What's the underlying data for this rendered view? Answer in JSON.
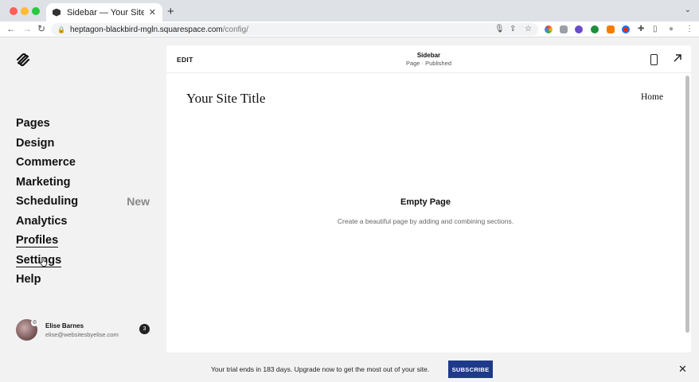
{
  "browser": {
    "tab_title": "Sidebar — Your Site Title",
    "tab_close": "✕",
    "new_tab": "+",
    "tab_menu": "⌄",
    "url_host": "heptagon-blackbird-mgln.squarespace.com",
    "url_path": "/config/",
    "back": "←",
    "forward": "→",
    "reload": "↻",
    "lock": "🔒",
    "mic": "🎙",
    "share": "⇪",
    "star": "☆",
    "puzzle": "✚",
    "sidebar_toggle": "▯",
    "profile": "●",
    "menu": "⋮"
  },
  "sidebar": {
    "items": [
      {
        "label": "Pages"
      },
      {
        "label": "Design"
      },
      {
        "label": "Commerce"
      },
      {
        "label": "Marketing"
      },
      {
        "label": "Scheduling",
        "badge": "New"
      },
      {
        "label": "Analytics"
      },
      {
        "label": "Profiles"
      },
      {
        "label": "Settings"
      },
      {
        "label": "Help"
      }
    ],
    "user": {
      "name": "Elise Barnes",
      "email": "elise@websitesbyelise.com",
      "notifications": "3",
      "gear": "⚙"
    }
  },
  "editor": {
    "edit_label": "EDIT",
    "page_name": "Sidebar",
    "page_status": "Page · Published",
    "site_title": "Your Site Title",
    "nav_home": "Home",
    "empty_title": "Empty Page",
    "empty_description": "Create a beautiful page by adding and combining sections."
  },
  "banner": {
    "text": "Your trial ends in 183 days. Upgrade now to get the most out of your site.",
    "subscribe_label": "SUBSCRIBE",
    "close": "✕"
  }
}
